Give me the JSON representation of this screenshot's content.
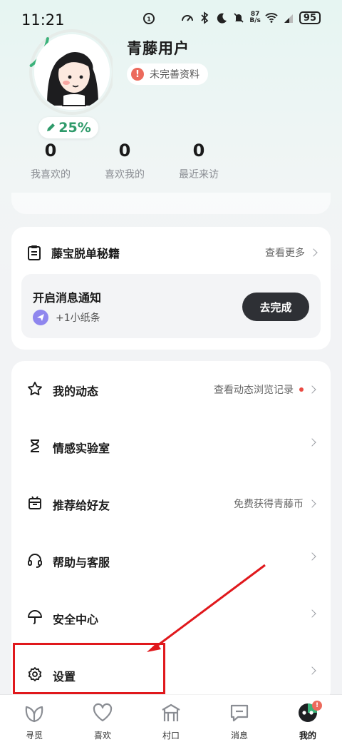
{
  "status_bar": {
    "time": "11:21",
    "net_speed_value": "87",
    "net_speed_unit": "B/s",
    "battery": "95"
  },
  "profile": {
    "user_name": "青藤用户",
    "completion": "25%",
    "completion_fraction": 0.25,
    "incomplete_badge": "未完善资料",
    "warn_glyph": "!"
  },
  "stats": [
    {
      "value": "0",
      "label": "我喜欢的"
    },
    {
      "value": "0",
      "label": "喜欢我的"
    },
    {
      "value": "0",
      "label": "最近来访"
    }
  ],
  "guide": {
    "title": "藤宝脱单秘籍",
    "more_label": "查看更多",
    "notify_title": "开启消息通知",
    "notify_sub": "+1小纸条",
    "notify_button": "去完成"
  },
  "menu": [
    {
      "icon": "star-icon",
      "label": "我的动态",
      "right": "查看动态浏览记录",
      "dot": true
    },
    {
      "icon": "hourglass-icon",
      "label": "情感实验室",
      "right": ""
    },
    {
      "icon": "gift-icon",
      "label": "推荐给好友",
      "right": "免费获得青藤币"
    },
    {
      "icon": "headset-icon",
      "label": "帮助与客服",
      "right": ""
    },
    {
      "icon": "umbrella-icon",
      "label": "安全中心",
      "right": ""
    },
    {
      "icon": "gear-icon",
      "label": "设置",
      "right": ""
    }
  ],
  "tabbar": [
    {
      "icon": "leaf-icon",
      "label": "寻觅"
    },
    {
      "icon": "heart-icon",
      "label": "喜欢"
    },
    {
      "icon": "gate-icon",
      "label": "村口"
    },
    {
      "icon": "message-icon",
      "label": "消息"
    },
    {
      "icon": "mine-icon",
      "label": "我的",
      "active": true,
      "badge": "!"
    }
  ],
  "colors": {
    "accent_green": "#2f9a6a",
    "annotation_red": "#e0181c",
    "button_dark": "#2e3035"
  }
}
